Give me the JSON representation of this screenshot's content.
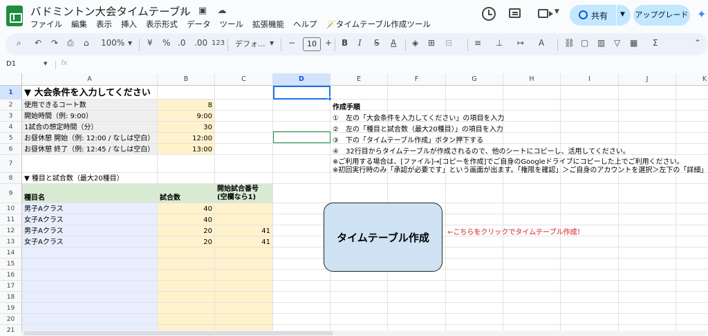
{
  "app": {
    "title": "バドミントン大会タイムテーブル",
    "menu": [
      "ファイル",
      "編集",
      "表示",
      "挿入",
      "表示形式",
      "データ",
      "ツール",
      "拡張機能",
      "ヘルプ",
      "🪄タイムテーブル作成ツール"
    ],
    "share_label": "共有",
    "upgrade_label": "アップグレード"
  },
  "toolbar": {
    "zoom": "100%",
    "currency": "¥",
    "percent": "%",
    "dec_less": ".0",
    "dec_more": ".00",
    "format_num": "123",
    "font": "デフォ...",
    "font_size": "10",
    "minus": "−",
    "plus": "+",
    "bold": "B",
    "italic": "I",
    "strike": "S",
    "textcolor": "A"
  },
  "formula": {
    "name_box": "D1",
    "fx": "fx"
  },
  "columns": [
    "A",
    "B",
    "C",
    "D",
    "E",
    "F",
    "G",
    "H",
    "I",
    "J",
    "K"
  ],
  "selected_column": "D",
  "rows": [
    "1",
    "2",
    "3",
    "4",
    "5",
    "6",
    "7",
    "8",
    "9",
    "10",
    "11",
    "12",
    "13",
    "14",
    "15",
    "16",
    "17",
    "18",
    "19",
    "20",
    "21"
  ],
  "sheet": {
    "a1": "▼ 大会条件を入力してください",
    "a2": "使用できるコート数",
    "b2": "8",
    "a3": "開始時間（例: 9:00）",
    "b3": "9:00",
    "a4": "1試合の想定時間（分）",
    "b4": "30",
    "a5": "お昼休憩 開始（例: 12:00 / なしは空白）",
    "b5": "12:00",
    "a6": "お昼休憩 終了（例: 12:45 / なしは空白）",
    "b6": "13:00",
    "a8": "▼ 種目と試合数（最大20種目）",
    "a9": "種目名",
    "b9": "試合数",
    "c9_1": "開始試合番号",
    "c9_2": "(空欄なら1)",
    "events": [
      {
        "name": "男子Aクラス",
        "matches": "40",
        "start": ""
      },
      {
        "name": "女子Aクラス",
        "matches": "40",
        "start": ""
      },
      {
        "name": "男子Aクラス",
        "matches": "20",
        "start": "41"
      },
      {
        "name": "女子Aクラス",
        "matches": "20",
        "start": "41"
      }
    ],
    "e2": "作成手順",
    "e3": "①　左の「大会条件を入力してください」の項目を入力",
    "e4": "②　左の「種目と試合数（最大20種目）」の項目を入力",
    "e5": "③　下の「タイムテーブル作成」ボタン押下する",
    "e6": "④　32行目からタイムテーブルが作成されるので、他のシートにコピーし、活用してください。",
    "e7_1": "※ご利用する場合は、[ファイル]→[コピーを作成]でご自身のGoogleドライブにコピーした上でご利用ください。",
    "e7_2": "※初回実行時のみ「承認が必要です」という画面が出ます。「権限を確認」＞ご自身のアカウントを選択＞左下の「詳細」",
    "button_label": "タイムテーブル作成",
    "button_note": "←こちらをクリックでタイムテーブル作成！"
  }
}
